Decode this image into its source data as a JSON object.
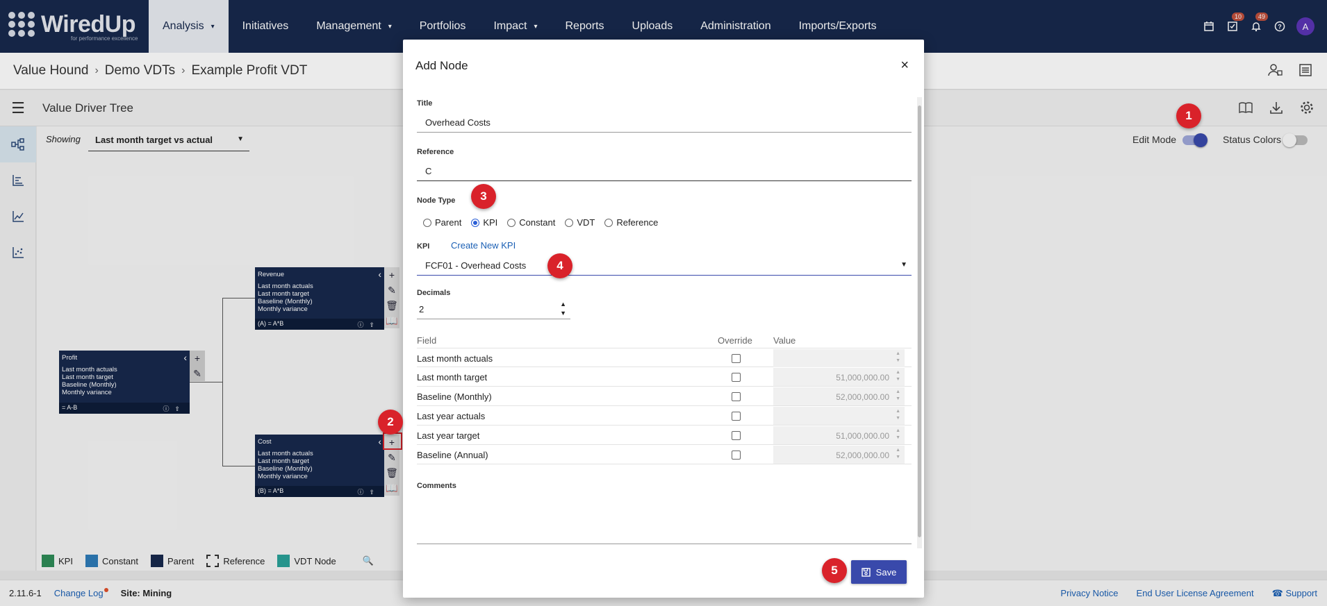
{
  "app": {
    "logo_text": "WiredUp",
    "logo_tagline": "for performance excellence"
  },
  "nav": {
    "items": [
      {
        "label": "Analysis",
        "has_caret": true,
        "active": true
      },
      {
        "label": "Initiatives"
      },
      {
        "label": "Management",
        "has_caret": true
      },
      {
        "label": "Portfolios"
      },
      {
        "label": "Impact",
        "has_caret": true
      },
      {
        "label": "Reports"
      },
      {
        "label": "Uploads"
      },
      {
        "label": "Administration"
      },
      {
        "label": "Imports/Exports"
      }
    ],
    "caret": "▾",
    "tasks_badge": "10",
    "notifications_badge": "49",
    "avatar_initial": "A"
  },
  "breadcrumb": {
    "items": [
      "Value Hound",
      "Demo VDTs",
      "Example Profit VDT"
    ]
  },
  "page": {
    "title": "Value Driver Tree",
    "showing_label": "Showing",
    "showing_value": "Last month target vs actual",
    "edit_mode_label": "Edit Mode",
    "edit_mode_on": true,
    "status_colors_label": "Status Colors",
    "status_colors_on": false
  },
  "nodes": {
    "profit": {
      "title": "Profit",
      "lines": [
        "Last month actuals",
        "Last month target",
        "Baseline (Monthly)",
        "Monthly variance"
      ],
      "formula": "= A-B"
    },
    "revenue": {
      "title": "Revenue",
      "lines": [
        "Last month actuals",
        "Last month target",
        "Baseline (Monthly)",
        "Monthly variance"
      ],
      "formula": "(A) = A*B"
    },
    "cost": {
      "title": "Cost",
      "lines": [
        "Last month actuals",
        "Last month target",
        "Baseline (Monthly)",
        "Monthly variance"
      ],
      "formula": "(B) = A*B"
    }
  },
  "legend": [
    {
      "label": "KPI",
      "color": "#2e8b57"
    },
    {
      "label": "Constant",
      "color": "#2e7bb8"
    },
    {
      "label": "Parent",
      "color": "#17294d"
    },
    {
      "label": "Reference",
      "color": "dashed"
    },
    {
      "label": "VDT Node",
      "color": "#2aa198"
    }
  ],
  "footer": {
    "version": "2.11.6-1",
    "change_log": "Change Log",
    "site_label": "Site: Mining",
    "privacy": "Privacy Notice",
    "eula": "End User License Agreement",
    "support": "Support"
  },
  "modal": {
    "title": "Add Node",
    "close": "×",
    "title_label": "Title",
    "title_value": "Overhead Costs",
    "reference_label": "Reference",
    "reference_value": "C",
    "node_type_label": "Node Type",
    "node_types": [
      {
        "label": "Parent",
        "selected": false
      },
      {
        "label": "KPI",
        "selected": true
      },
      {
        "label": "Constant",
        "selected": false
      },
      {
        "label": "VDT",
        "selected": false
      },
      {
        "label": "Reference",
        "selected": false
      }
    ],
    "kpi_label": "KPI",
    "create_kpi": "Create New KPI",
    "kpi_value": "FCF01 - Overhead Costs",
    "decimals_label": "Decimals",
    "decimals_value": "2",
    "table_headers": {
      "field": "Field",
      "override": "Override",
      "value": "Value"
    },
    "rows": [
      {
        "field": "Last month actuals",
        "value": ""
      },
      {
        "field": "Last month target",
        "value": "51,000,000.00"
      },
      {
        "field": "Baseline (Monthly)",
        "value": "52,000,000.00"
      },
      {
        "field": "Last year actuals",
        "value": ""
      },
      {
        "field": "Last year target",
        "value": "51,000,000.00"
      },
      {
        "field": "Baseline (Annual)",
        "value": "52,000,000.00"
      }
    ],
    "comments_label": "Comments",
    "save_label": "Save"
  },
  "callouts": [
    "1",
    "2",
    "3",
    "4",
    "5"
  ],
  "colors": {
    "nav_bg": "#17294d",
    "primary": "#3949ab",
    "callout": "#d9222a",
    "link": "#1a5fb4"
  }
}
